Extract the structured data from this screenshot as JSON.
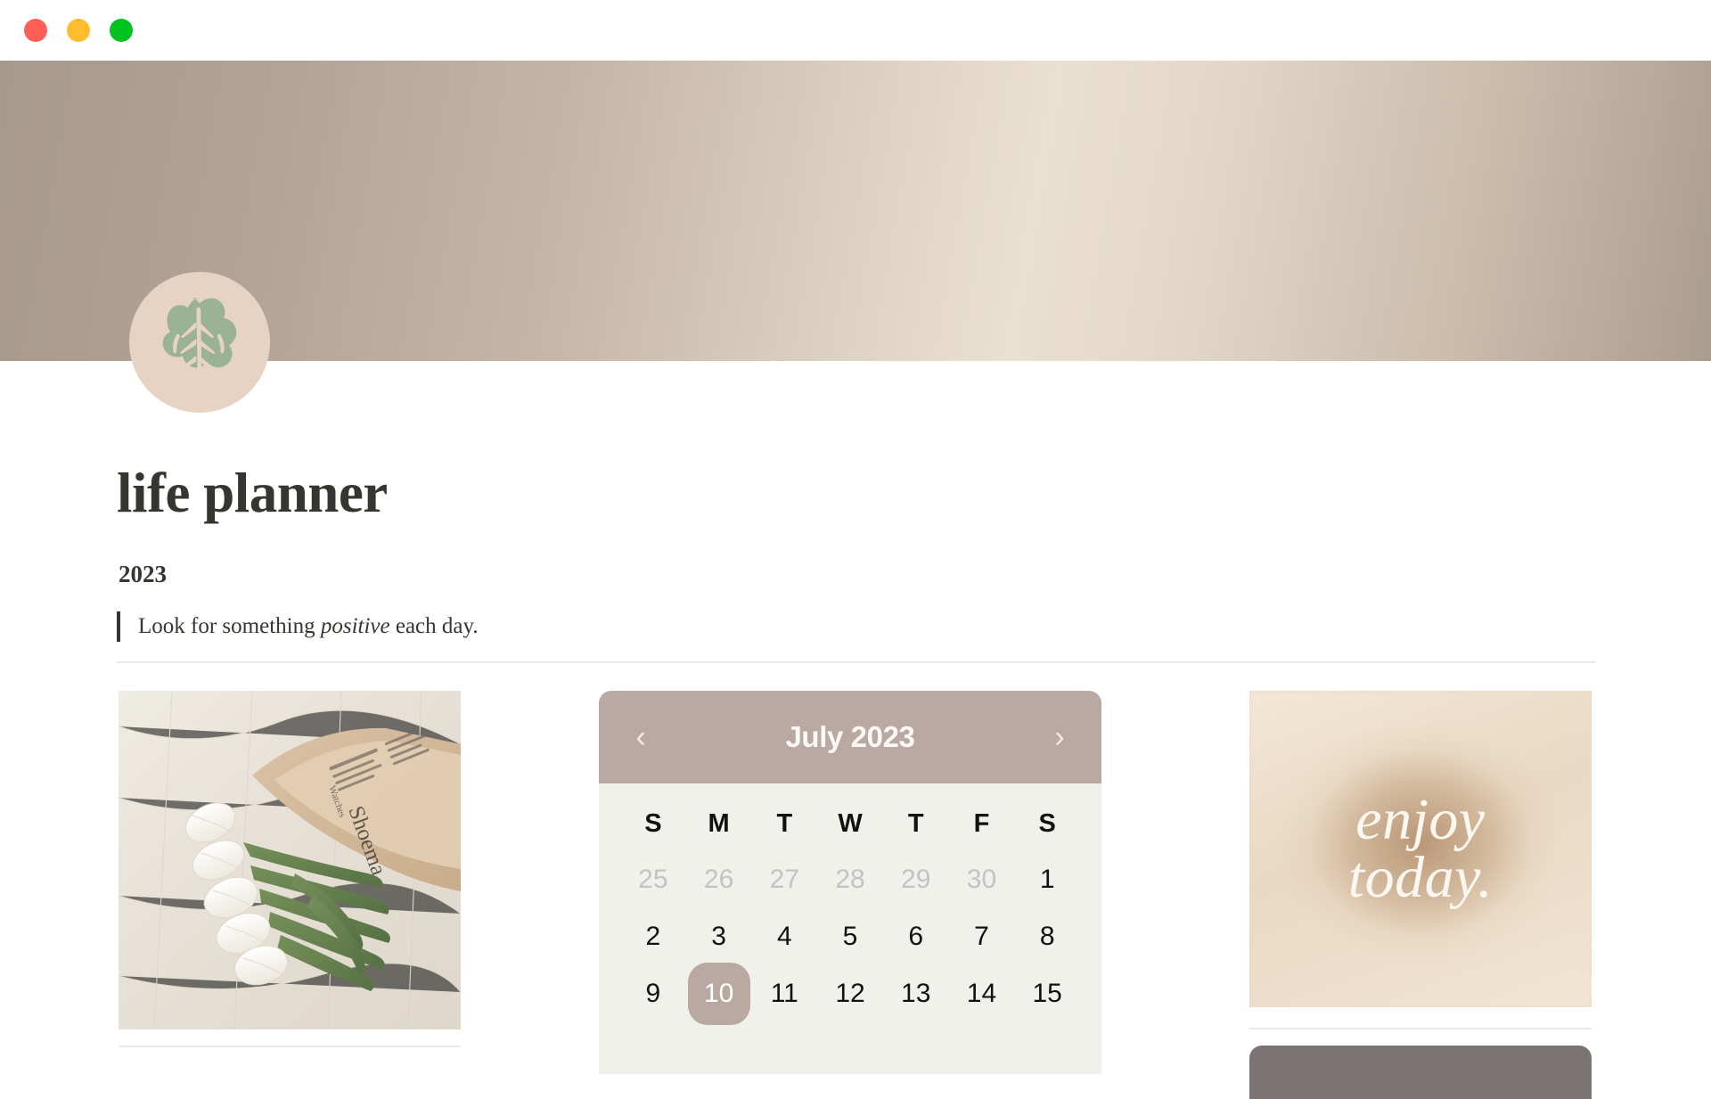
{
  "window": {
    "traffic_lights": [
      {
        "name": "close",
        "color": "#ff5f57"
      },
      {
        "name": "minimize",
        "color": "#ffbd2e"
      },
      {
        "name": "maximize",
        "color": "#00c322"
      }
    ]
  },
  "cover": {
    "gradient_colors": [
      "#a8998d",
      "#c6b6a8",
      "#eae0d2",
      "#ab9c90"
    ]
  },
  "avatar": {
    "icon": "monstera-leaf-icon",
    "background": "#e7d3c3",
    "leaf_color": "#9ab392"
  },
  "page": {
    "title": "life planner",
    "subtitle": "2023",
    "quote_prefix": "Look for something ",
    "quote_emphasis": "positive",
    "quote_suffix": " each day."
  },
  "photo": {
    "name": "white-tulips-newspaper-photo",
    "alt": "White tulips wrapped in newspaper on linen cloth"
  },
  "calendar": {
    "prev_label": "‹",
    "next_label": "›",
    "month_label": "July 2023",
    "header_color": "#b9a9a2",
    "body_color": "#f1f1ec",
    "today_highlight_color": "#b9a9a2",
    "weekdays": [
      "S",
      "M",
      "T",
      "W",
      "T",
      "F",
      "S"
    ],
    "weeks": [
      [
        {
          "d": "25",
          "muted": true
        },
        {
          "d": "26",
          "muted": true
        },
        {
          "d": "27",
          "muted": true
        },
        {
          "d": "28",
          "muted": true
        },
        {
          "d": "29",
          "muted": true
        },
        {
          "d": "30",
          "muted": true
        },
        {
          "d": "1",
          "muted": false
        }
      ],
      [
        {
          "d": "2",
          "muted": false
        },
        {
          "d": "3",
          "muted": false
        },
        {
          "d": "4",
          "muted": false
        },
        {
          "d": "5",
          "muted": false
        },
        {
          "d": "6",
          "muted": false
        },
        {
          "d": "7",
          "muted": false
        },
        {
          "d": "8",
          "muted": false
        }
      ],
      [
        {
          "d": "9",
          "muted": false
        },
        {
          "d": "10",
          "muted": false,
          "today": true
        },
        {
          "d": "11",
          "muted": false
        },
        {
          "d": "12",
          "muted": false
        },
        {
          "d": "13",
          "muted": false
        },
        {
          "d": "14",
          "muted": false
        },
        {
          "d": "15",
          "muted": false
        }
      ]
    ]
  },
  "quote_card": {
    "line1": "enjoy",
    "line2": "today.",
    "background": "#e3c6a5"
  },
  "dark_bar": {
    "color": "#7b7472"
  }
}
